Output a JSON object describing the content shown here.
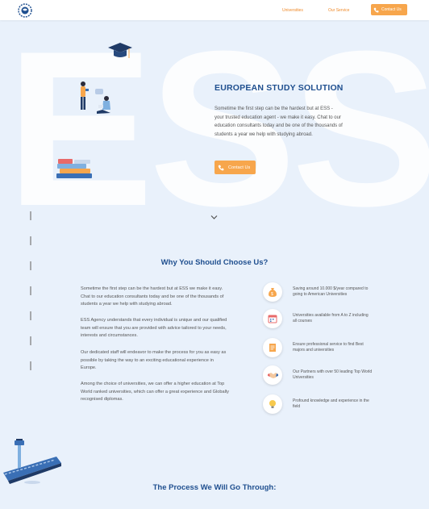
{
  "header": {
    "logo_icon": "globe-logo-icon",
    "nav": [
      {
        "label": "Universities"
      },
      {
        "label": "Our Service"
      }
    ],
    "contact_label": "Contact Us"
  },
  "hero": {
    "big_letters": "ESS",
    "title": "EUROPEAN STUDY SOLUTION",
    "description": "Sometime the first step can be the hardest but at ESS - your trusted education agent - we make it easy. Chat to our education consultants today and be one of the thousands of students a year we help with studying abroad.",
    "button_label": "Contact Us"
  },
  "why": {
    "title": "Why You Should Choose Us?",
    "paragraphs": [
      "Sometime the first step can be the hardest but at ESS we make it easy. Chat to our education consultants today and be one of the thousands of students a year we help with studying abroad.",
      "ESS Agency understands that every individual is unique and our qualified team will ensure that you are provided with advice tailored to your needs, interests and circumstances.",
      "Our dedicated staff will endeavor to make the process for you as easy as possible by taking the way to an exciting educational experience in Europe.",
      "Among the choice of universities, we can offer a higher education at Top World ranked universities, which can offer a great experience and Globally recognised diplomas."
    ],
    "features": [
      {
        "icon": "money-bag-icon",
        "text": "Saving around 10.000 $/year compared to going to American Universities"
      },
      {
        "icon": "calendar-icon",
        "text": "Universities available from A to Z including all courses"
      },
      {
        "icon": "document-icon",
        "text": "Ensure professional service to find Best majors and universities"
      },
      {
        "icon": "handshake-icon",
        "text": "Our Partners with over 50 leading Top World Universities"
      },
      {
        "icon": "lightbulb-icon",
        "text": "Profound knowledge and experience in the field"
      }
    ]
  },
  "process": {
    "title": "The Process We Will Go Through:"
  },
  "colors": {
    "accent": "#f7a64c",
    "title": "#1f4f8f",
    "background": "#e9f1fb"
  }
}
